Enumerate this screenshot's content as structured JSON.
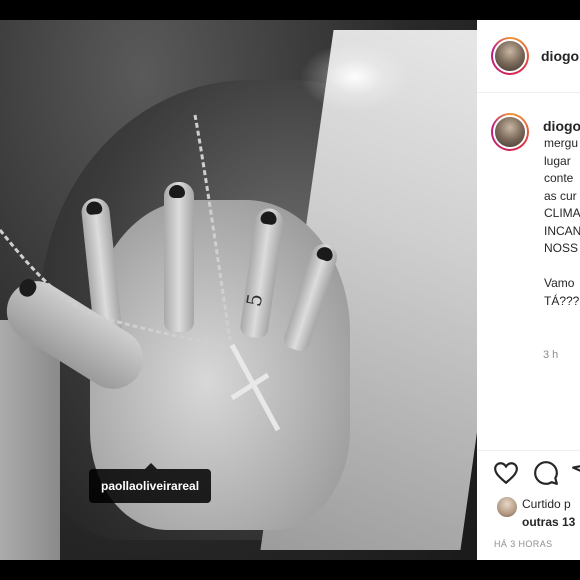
{
  "post": {
    "tag_label": "paollaoliveirareal",
    "tattoo_text": "5"
  },
  "header": {
    "username": "diogo"
  },
  "caption": {
    "username": "diogo",
    "lines": "mergu\nlugar\nconte\nas cur\nCLIMA\nINCAN\nNOSS\n\nVamo\nTÁ???",
    "time": "3 h"
  },
  "likes": {
    "line1": "Curtido p",
    "line2": "outras 13"
  },
  "timestamp": "HÁ 3 HORAS",
  "icons": [
    "heart-icon",
    "comment-icon",
    "share-icon"
  ]
}
